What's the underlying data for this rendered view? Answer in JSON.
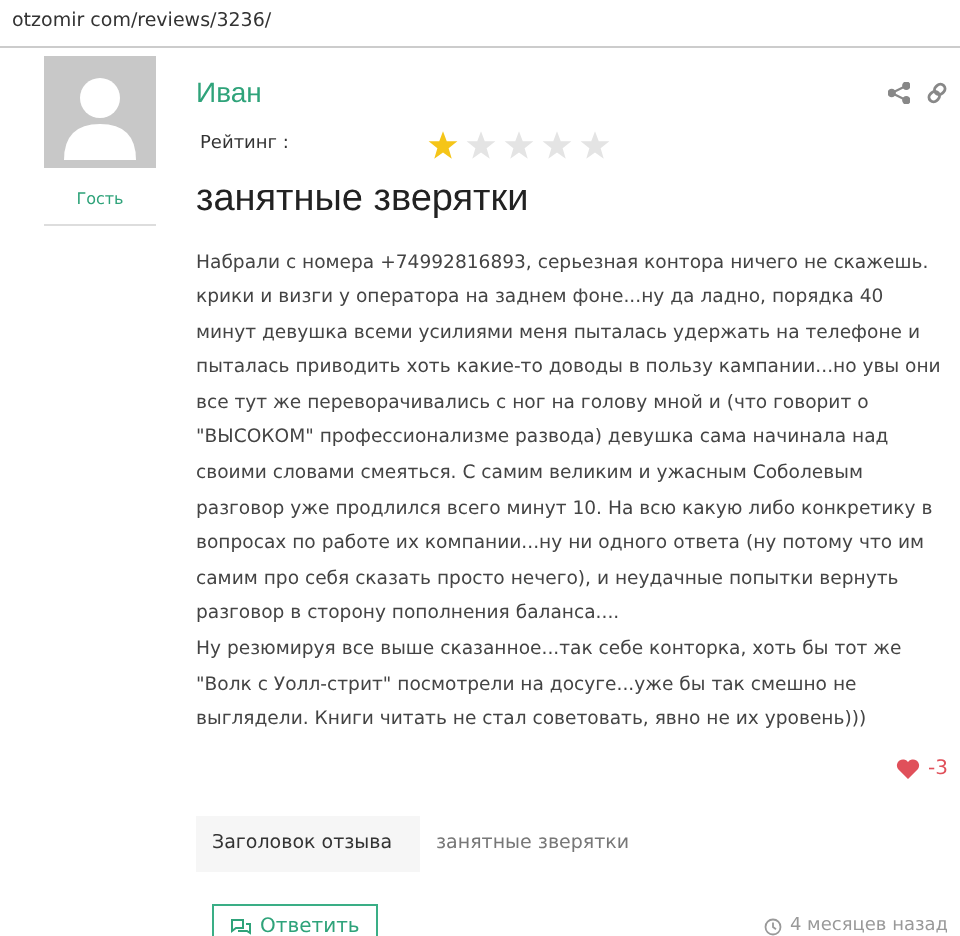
{
  "address_bar": {
    "url": "otzomir com/reviews/3236/"
  },
  "author": {
    "name": "Иван",
    "role": "Гость"
  },
  "rating": {
    "label": "Рейтинг :",
    "stars": 1
  },
  "review": {
    "title": "занятные зверятки",
    "paragraphs": [
      "Набрали с номера +74992816893, серьезная контора ничего не скажешь. крики и визги у оператора на заднем фоне...ну да ладно, порядка 40 минут девушка всеми усилиями меня пыталась удержать на телефоне и пыталась приводить хоть какие-то доводы в пользу кампании...но увы они все тут же переворачивались с ног на голову мной и (что говорит о \"ВЫСОКОМ\" профессионализме развода) девушка сама начинала над своими словами смеяться. С самим великим и ужасным Соболевым разговор уже продлился всего минут 10. На всю какую либо конкретику в вопросах по работе их компании...ну ни одного ответа (ну потому что им самим про себя сказать просто нечего), и неудачные попытки вернуть разговор в сторону пополнения баланса....",
      "Ну резюмируя все выше сказанное...так себе конторка, хоть бы тот же \"Волк с Уолл-стрит\" посмотрели на досуге...уже бы так смешно не выглядели. Книги читать не стал советовать, явно не их уровень)))"
    ],
    "likes": "-3"
  },
  "details": [
    {
      "label": "Заголовок отзыва",
      "value": "занятные зверятки"
    }
  ],
  "footer": {
    "reply_button": "Ответить",
    "time": "4 месяцев назад"
  }
}
